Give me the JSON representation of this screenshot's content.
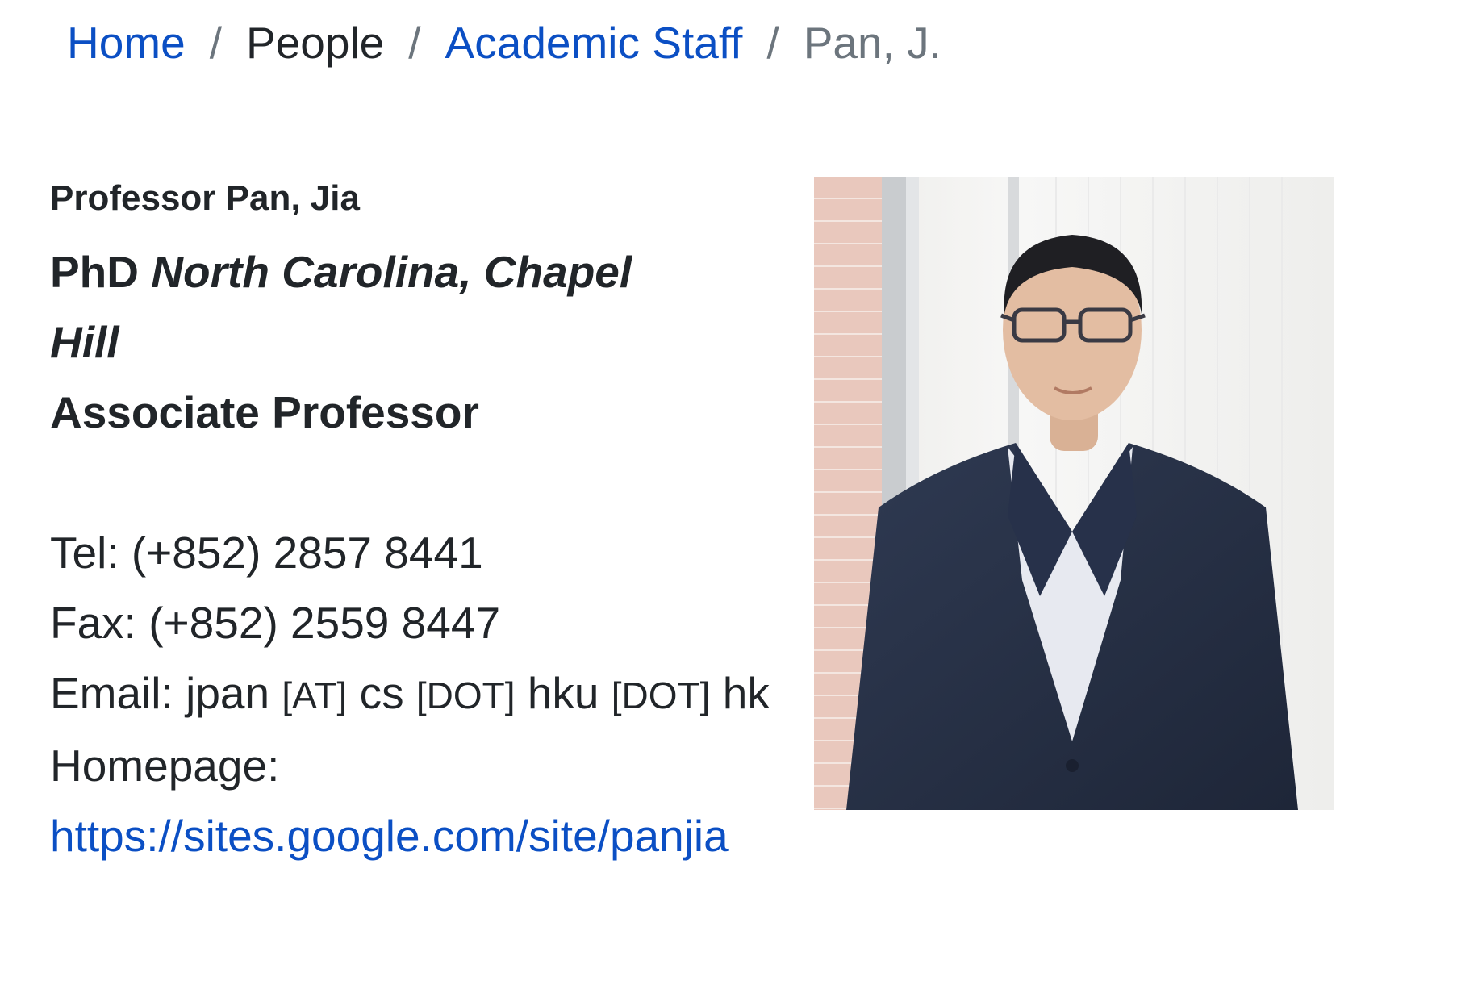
{
  "breadcrumb": {
    "home": "Home",
    "people": "People",
    "academic_staff": "Academic Staff",
    "current": "Pan, J.",
    "separator": "/"
  },
  "profile": {
    "name": "Professor Pan, Jia",
    "degree_prefix": "PhD",
    "degree_institution": "North Carolina, Chapel Hill",
    "position": "Associate Professor",
    "tel": "Tel: (+852) 2857 8441",
    "fax": "Fax: (+852) 2559 8447",
    "email_label": "Email: ",
    "email_user": "jpan",
    "email_at": "[AT]",
    "email_domain1": "cs",
    "email_dot": "[DOT]",
    "email_domain2": "hku",
    "email_domain3": "hk",
    "homepage_label": "Homepage:",
    "homepage_url": "https://sites.google.com/site/panjia"
  },
  "colors": {
    "link": "#0b4fc4",
    "text": "#212529",
    "muted": "#6c757d"
  }
}
